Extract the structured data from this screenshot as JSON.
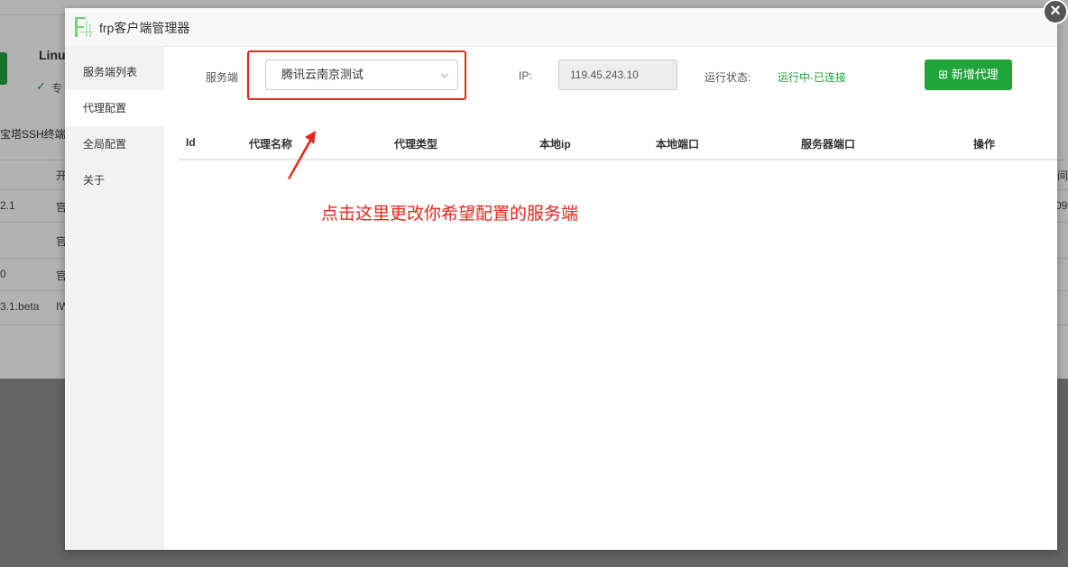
{
  "background": {
    "title": "Linu",
    "check_text": "专",
    "ssh_text": "宝塔SSH终端",
    "col_header_1": "开",
    "col_header_2": "间",
    "rows": [
      {
        "version": "2.1",
        "col": "官",
        "right": "09,"
      },
      {
        "version": "",
        "col": "官",
        "right": ""
      },
      {
        "version": "0",
        "col": "官",
        "right": ""
      },
      {
        "version": "3.1.beta",
        "col": "IW",
        "right": ""
      }
    ]
  },
  "modal": {
    "title": "frp客户端管理器",
    "close_icon": "close-icon",
    "sidebar": [
      {
        "label": "服务端列表",
        "active": false
      },
      {
        "label": "代理配置",
        "active": true
      },
      {
        "label": "全局配置",
        "active": false
      },
      {
        "label": "关于",
        "active": false
      }
    ],
    "server_label": "服务端",
    "server_selected": "腾讯云南京测试",
    "ip_label": "IP:",
    "ip_value": "119.45.243.10",
    "status_label": "运行状态:",
    "status_value": "运行中-已连接",
    "add_button": "新增代理",
    "table_headers": [
      "Id",
      "代理名称",
      "代理类型",
      "本地ip",
      "本地端口",
      "服务器端口",
      "操作"
    ],
    "annotation": "点击这里更改你希望配置的服务端"
  },
  "colors": {
    "accent": "#20a53a",
    "annotation_red": "#e8251b"
  }
}
